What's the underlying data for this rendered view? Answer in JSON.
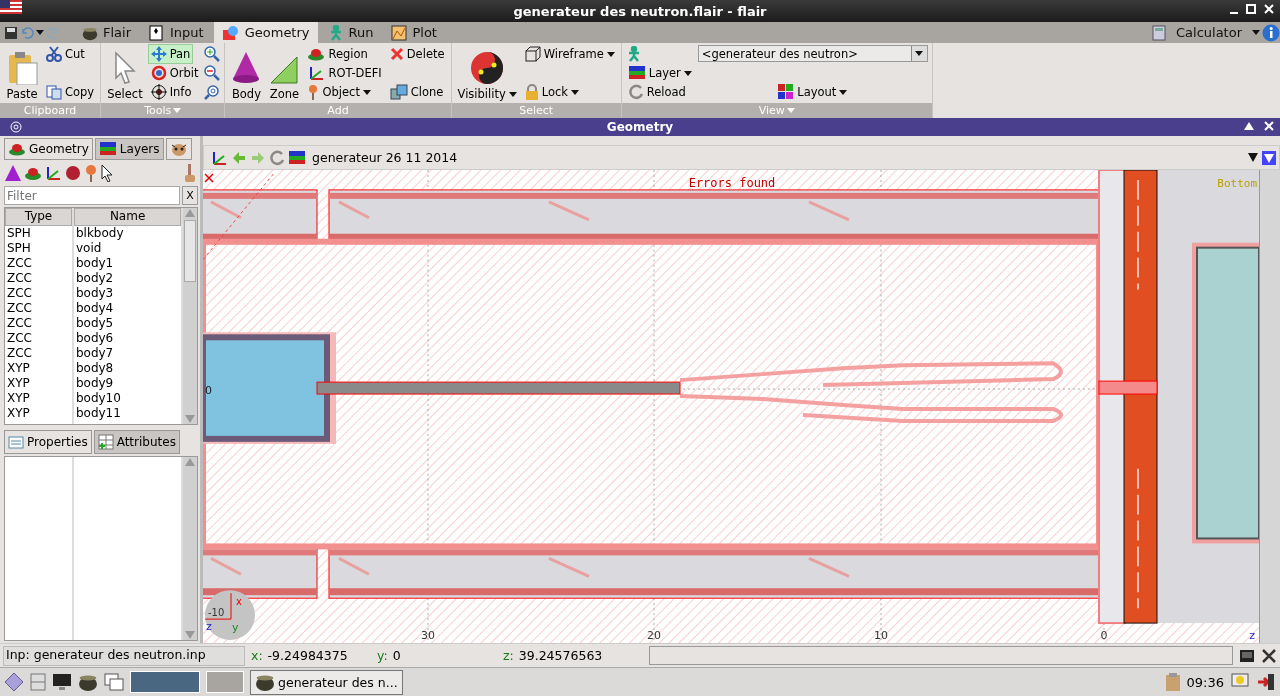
{
  "window": {
    "title": "generateur des neutron.flair - flair"
  },
  "ribbon_tabs": [
    {
      "label": "Flair",
      "selected": false
    },
    {
      "label": "Input",
      "selected": false
    },
    {
      "label": "Geometry",
      "selected": true
    },
    {
      "label": "Run",
      "selected": false
    },
    {
      "label": "Plot",
      "selected": false
    }
  ],
  "calculator": "Calculator",
  "ribbon_groups": [
    {
      "label": "Clipboard",
      "menu": false,
      "columns": [
        [
          {
            "kind": "large",
            "label": "Paste",
            "menu": false,
            "active": false
          }
        ],
        [
          {
            "kind": "small",
            "label": "Cut",
            "menu": false,
            "active": false
          },
          {
            "kind": "small",
            "label": "Copy",
            "menu": false,
            "active": false
          }
        ]
      ]
    },
    {
      "label": "Tools",
      "menu": true,
      "columns": [
        [
          {
            "kind": "large",
            "label": "Select",
            "menu": false,
            "active": false
          }
        ],
        [
          {
            "kind": "small",
            "label": "Pan",
            "menu": false,
            "active": true
          },
          {
            "kind": "small",
            "label": "Orbit",
            "menu": false,
            "active": false
          },
          {
            "kind": "small",
            "label": "Info",
            "menu": false,
            "active": false
          }
        ],
        [
          {
            "kind": "icon",
            "menu": false,
            "active": false
          },
          {
            "kind": "icon",
            "menu": false,
            "active": false
          },
          {
            "kind": "icon",
            "menu": false,
            "active": false
          }
        ]
      ]
    },
    {
      "label": "Add",
      "menu": false,
      "columns": [
        [
          {
            "kind": "large",
            "label": "Body",
            "menu": false,
            "active": false
          }
        ],
        [
          {
            "kind": "large",
            "label": "Zone",
            "menu": false,
            "active": false
          }
        ],
        [
          {
            "kind": "small",
            "label": "Region",
            "menu": false,
            "active": false
          },
          {
            "kind": "small",
            "label": "ROT-DEFI",
            "menu": false,
            "active": false
          },
          {
            "kind": "small",
            "label": "Object",
            "menu": true,
            "active": false
          }
        ],
        [
          {
            "kind": "small",
            "label": "Delete",
            "menu": false,
            "active": false
          },
          {
            "kind": "small",
            "label": "Clone",
            "menu": false,
            "active": false
          }
        ]
      ]
    },
    {
      "label": "Select",
      "menu": false,
      "columns": [
        [
          {
            "kind": "large",
            "label": "Visibility",
            "menu": true,
            "active": false
          }
        ],
        [
          {
            "kind": "small",
            "label": "Wireframe",
            "menu": true,
            "active": false
          },
          {
            "kind": "small",
            "label": "Lock",
            "menu": true,
            "active": false
          }
        ]
      ]
    },
    {
      "label": "View",
      "menu": true,
      "columns": [
        [
          {
            "kind": "icon",
            "menu": false,
            "active": false
          },
          {
            "kind": "small",
            "label": "Layer",
            "menu": true,
            "active": false
          },
          {
            "kind": "small",
            "label": "Reload",
            "menu": false,
            "active": false
          }
        ],
        [
          {
            "kind": "combo",
            "value": "<generateur des neutron>",
            "menu": false,
            "active": false
          },
          {
            "kind": "small",
            "label": "Layout",
            "menu": true,
            "active": false
          }
        ]
      ]
    }
  ],
  "panel": {
    "title": "Geometry"
  },
  "left_tabs": [
    {
      "label": "Geometry",
      "selected": false
    },
    {
      "label": "Layers",
      "selected": true
    }
  ],
  "filter": {
    "placeholder": "Filter",
    "clear": "X"
  },
  "bodies": {
    "columns": [
      "Type",
      "Name"
    ],
    "rows": [
      [
        "SPH",
        "blkbody"
      ],
      [
        "SPH",
        "void"
      ],
      [
        "ZCC",
        "body1"
      ],
      [
        "ZCC",
        "body2"
      ],
      [
        "ZCC",
        "body3"
      ],
      [
        "ZCC",
        "body4"
      ],
      [
        "ZCC",
        "body5"
      ],
      [
        "ZCC",
        "body6"
      ],
      [
        "ZCC",
        "body7"
      ],
      [
        "XYP",
        "body8"
      ],
      [
        "XYP",
        "body9"
      ],
      [
        "XYP",
        "body10"
      ],
      [
        "XYP",
        "body11"
      ]
    ]
  },
  "bottom_tabs": [
    {
      "label": "Properties",
      "selected": false
    },
    {
      "label": "Attributes",
      "selected": true
    }
  ],
  "viewport": {
    "layer": "generateur 26 11 2014",
    "message": "Errors found",
    "view": "Bottom",
    "origin": "0",
    "ticks": [
      "30",
      "20",
      "10",
      "0"
    ],
    "axis": "z",
    "gizmo": {
      "x": "x",
      "y": "y",
      "z": "z",
      "scale": "-10"
    }
  },
  "status_bar": {
    "file": "Inp: generateur des neutron.inp",
    "coords": [
      {
        "axis": "x:",
        "value": "-9.24984375"
      },
      {
        "axis": "y:",
        "value": "0"
      },
      {
        "axis": "z:",
        "value": "39.24576563"
      }
    ]
  },
  "taskbar": {
    "window": "generateur des n...",
    "clock": "09:36"
  }
}
